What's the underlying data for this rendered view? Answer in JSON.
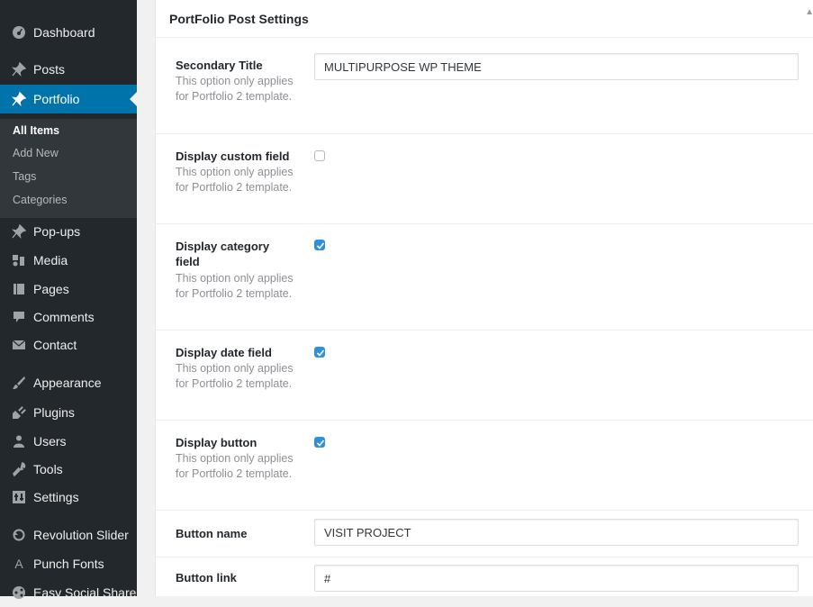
{
  "sidebar": {
    "items": [
      {
        "label": "Dashboard",
        "icon": "dashboard-icon"
      },
      {
        "label": "Posts",
        "icon": "pin-icon"
      },
      {
        "label": "Portfolio",
        "icon": "pin-icon",
        "active": true
      },
      {
        "label": "Pop-ups",
        "icon": "pin-icon"
      },
      {
        "label": "Media",
        "icon": "media-icon"
      },
      {
        "label": "Pages",
        "icon": "pages-icon"
      },
      {
        "label": "Comments",
        "icon": "comment-icon"
      },
      {
        "label": "Contact",
        "icon": "mail-icon"
      },
      {
        "label": "Appearance",
        "icon": "brush-icon"
      },
      {
        "label": "Plugins",
        "icon": "plug-icon"
      },
      {
        "label": "Users",
        "icon": "user-icon"
      },
      {
        "label": "Tools",
        "icon": "wrench-icon"
      },
      {
        "label": "Settings",
        "icon": "settings-icon"
      },
      {
        "label": "Revolution Slider",
        "icon": "refresh-icon"
      },
      {
        "label": "Punch Fonts",
        "icon": "font-icon"
      },
      {
        "label": "Easy Social Share",
        "icon": "share-icon"
      }
    ],
    "submenu": [
      "All Items",
      "Add New",
      "Tags",
      "Categories"
    ]
  },
  "panel": {
    "title": "PortFolio Post Settings",
    "fields": {
      "secondary_title": {
        "label": "Secondary Title",
        "desc": "This option only applies for Portfolio 2 template.",
        "value": "MULTIPURPOSE WP THEME"
      },
      "custom_field": {
        "label": "Display custom field",
        "desc": "This option only applies for Portfolio 2 template.",
        "checked": false
      },
      "category_field": {
        "label": "Display category field",
        "desc": "This option only applies for Portfolio 2 template.",
        "checked": true
      },
      "date_field": {
        "label": "Display date field",
        "desc": "This option only applies for Portfolio 2 template.",
        "checked": true
      },
      "display_button": {
        "label": "Display button",
        "desc": "This option only applies for Portfolio 2 template.",
        "checked": true
      },
      "button_name": {
        "label": "Button name",
        "value": "VISIT PROJECT"
      },
      "button_link": {
        "label": "Button link",
        "value": "#"
      }
    }
  },
  "colors": {
    "sidebar_bg": "#23282d",
    "active_bg": "#0073aa",
    "checkbox_checked": "#2e8fdf"
  }
}
